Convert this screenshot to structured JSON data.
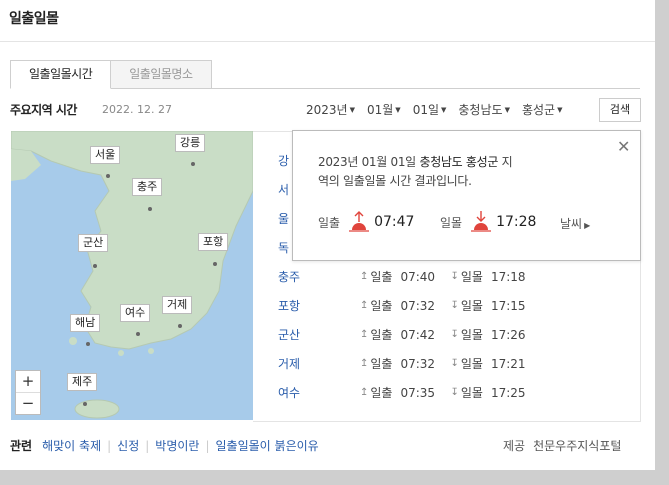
{
  "title": "일출일몰",
  "tabs": [
    {
      "label": "일출일몰시간"
    },
    {
      "label": "일출일몰명소"
    }
  ],
  "section": {
    "heading": "주요지역 시간",
    "date": "2022. 12. 27"
  },
  "selects": {
    "year": "2023년",
    "month": "01월",
    "day": "01일",
    "province": "충청남도",
    "county": "홍성군"
  },
  "search_label": "검색",
  "map": {
    "labels": [
      "서울",
      "강릉",
      "충주",
      "군산",
      "포항",
      "해남",
      "여수",
      "거제",
      "제주"
    ],
    "zoom_in": "+",
    "zoom_out": "−"
  },
  "city_links_partial": [
    "강",
    "서",
    "울",
    "독"
  ],
  "rows": [
    {
      "city": "충주",
      "sunrise_label": "일출",
      "sunrise": "07:40",
      "sunset_label": "일몰",
      "sunset": "17:18"
    },
    {
      "city": "포항",
      "sunrise_label": "일출",
      "sunrise": "07:32",
      "sunset_label": "일몰",
      "sunset": "17:15"
    },
    {
      "city": "군산",
      "sunrise_label": "일출",
      "sunrise": "07:42",
      "sunset_label": "일몰",
      "sunset": "17:26"
    },
    {
      "city": "거제",
      "sunrise_label": "일출",
      "sunrise": "07:32",
      "sunset_label": "일몰",
      "sunset": "17:21"
    },
    {
      "city": "여수",
      "sunrise_label": "일출",
      "sunrise": "07:35",
      "sunset_label": "일몰",
      "sunset": "17:25"
    }
  ],
  "popup": {
    "line1_date": "2023년 01월 01일",
    "line1_place": "충청남도 홍성군",
    "line1_suffix": "지",
    "line2": "역의 일출일몰 시간 결과입니다.",
    "sunrise_label": "일출",
    "sunrise": "07:47",
    "sunset_label": "일몰",
    "sunset": "17:28",
    "weather_link": "날씨",
    "close_icon": "close-icon"
  },
  "related": {
    "head": "관련",
    "links": [
      "해맞이 축제",
      "신정",
      "박명이란",
      "일출일몰이 붉은이유"
    ]
  },
  "provider": {
    "label": "제공",
    "name": "천문우주지식포털"
  },
  "colors": {
    "link": "#2a5dab",
    "sun_red": "#e0443c",
    "sea": "#a7cbea",
    "land": "#c9ddc6"
  }
}
